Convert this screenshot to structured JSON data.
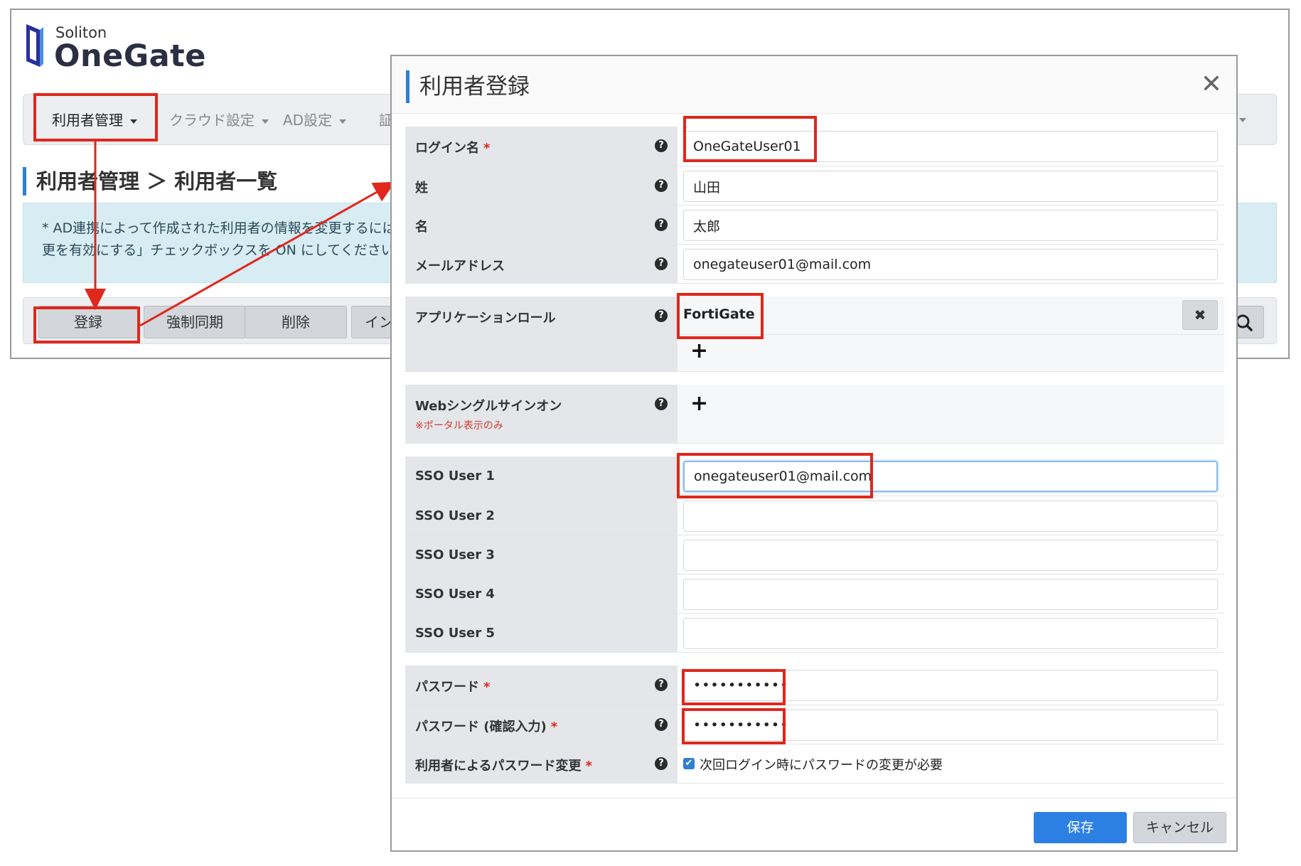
{
  "app": {
    "vendor": "Soliton",
    "product": "OneGate"
  },
  "nav": {
    "items": [
      {
        "label": "利用者管理"
      },
      {
        "label": "クラウド設定"
      },
      {
        "label": "AD設定"
      },
      {
        "label": "証"
      }
    ]
  },
  "page": {
    "breadcrumb": "利用者管理 ＞ 利用者一覧",
    "info_line1": "* AD連携によって作成された利用者の情報を変更するには、",
    "info_line2": "更を有効にする」チェックボックスを ON にしてください。"
  },
  "toolbar": {
    "register": "登録",
    "force_sync": "強制同期",
    "delete": "削除",
    "import": "イン"
  },
  "dialog": {
    "title": "利用者登録",
    "fields": {
      "login": {
        "label": "ログイン名",
        "value": "OneGateUser01",
        "required": "*"
      },
      "last_name": {
        "label": "姓",
        "value": "山田"
      },
      "first_name": {
        "label": "名",
        "value": "太郎"
      },
      "email": {
        "label": "メールアドレス",
        "value": "onegateuser01@mail.com"
      },
      "app_role": {
        "label": "アプリケーションロール",
        "value": "FortiGate"
      },
      "web_sso": {
        "label": "Webシングルサインオン",
        "note": "※ポータル表示のみ"
      },
      "sso1": {
        "label": "SSO User 1",
        "value": "onegateuser01@mail.com"
      },
      "sso2": {
        "label": "SSO User 2",
        "value": ""
      },
      "sso3": {
        "label": "SSO User 3",
        "value": ""
      },
      "sso4": {
        "label": "SSO User 4",
        "value": ""
      },
      "sso5": {
        "label": "SSO User 5",
        "value": ""
      },
      "password": {
        "label": "パスワード",
        "value": "•••••••••••",
        "required": "*"
      },
      "password_confirm": {
        "label": "パスワード (確認入力)",
        "value": "•••••••••••",
        "required": "*"
      },
      "password_change": {
        "label": "利用者によるパスワード変更",
        "required": "*",
        "checkbox_label": "次回ログイン時にパスワードの変更が必要",
        "checked": true
      }
    },
    "buttons": {
      "save": "保存",
      "cancel": "キャンセル"
    }
  },
  "colors": {
    "accent": "#2f7fd1",
    "annotation": "#e0271c",
    "save_button": "#2d80e3"
  }
}
